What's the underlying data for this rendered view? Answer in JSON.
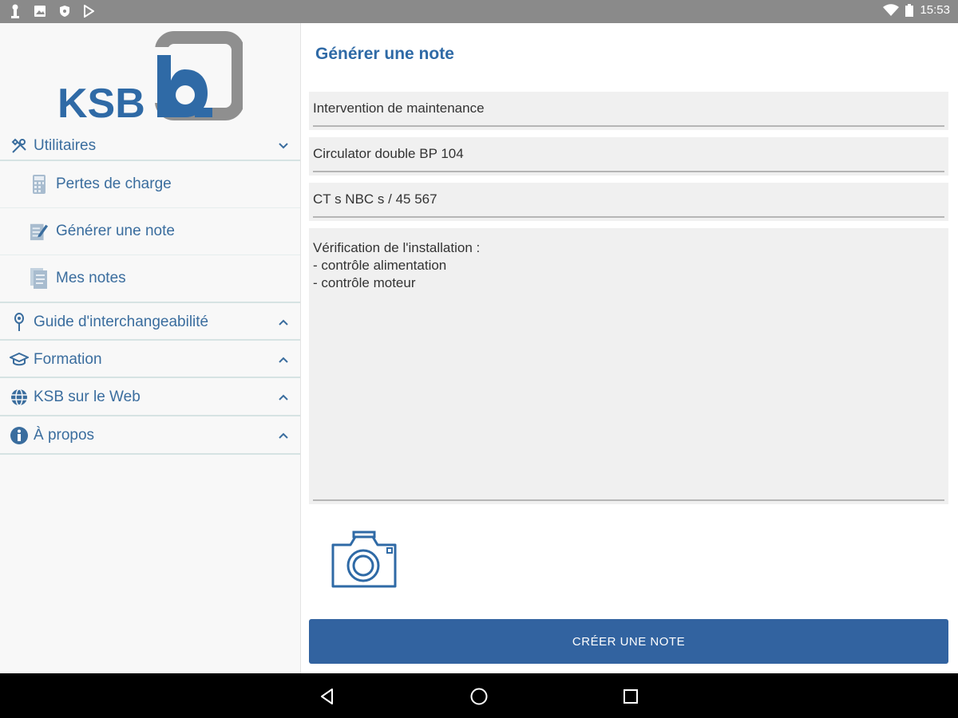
{
  "status_bar": {
    "time": "15:53"
  },
  "logo": {
    "text": "KSB"
  },
  "sidebar": {
    "sections": [
      {
        "label": "Utilitaires",
        "icon": "tools-icon",
        "expanded": true
      },
      {
        "label": "Guide d'interchangeabilité",
        "icon": "pin-icon"
      },
      {
        "label": "Formation",
        "icon": "graduation-cap-icon"
      },
      {
        "label": "KSB sur le Web",
        "icon": "globe-icon"
      },
      {
        "label": "À propos",
        "icon": "info-icon"
      }
    ],
    "sub_items": [
      {
        "label": "Pertes de charge",
        "icon": "calculator-icon"
      },
      {
        "label": "Générer une note",
        "icon": "edit-note-icon"
      },
      {
        "label": "Mes notes",
        "icon": "notes-icon"
      }
    ]
  },
  "main": {
    "title": "Générer une note",
    "fields": {
      "field1": "Intervention de maintenance",
      "field2": "Circulator double BP 104",
      "field3": "CT s NBC s / 45 567",
      "notes": "Vérification de l'installation :\n- contrôle alimentation\n- contrôle moteur"
    },
    "create_button": "CRÉER UNE NOTE"
  },
  "colors": {
    "accent": "#2f6aa6",
    "button": "#3263a0",
    "nav_text": "#3a6d9e",
    "status_bar": "#8a8a8a"
  }
}
